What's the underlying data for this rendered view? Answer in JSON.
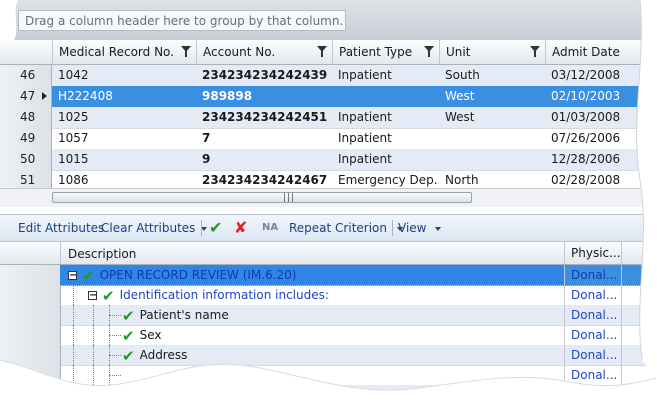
{
  "group_hint": "Drag a column header here to group by that column.",
  "columns": [
    "Medical Record No.",
    "Account No.",
    "Patient Type",
    "Unit",
    "Admit Date"
  ],
  "rows": [
    {
      "rownum": "46",
      "mrn": "1042",
      "account": "234234234242439",
      "type": "Inpatient",
      "unit": "South",
      "admit": "03/12/2008",
      "state": "alt"
    },
    {
      "rownum": "47",
      "mrn": "H222408",
      "account": "989898",
      "type": "",
      "unit": "West",
      "admit": "02/10/2003",
      "state": "sel"
    },
    {
      "rownum": "48",
      "mrn": "1025",
      "account": "234234234242451",
      "type": "Inpatient",
      "unit": "West",
      "admit": "01/03/2008",
      "state": "alt"
    },
    {
      "rownum": "49",
      "mrn": "1057",
      "account": "7",
      "type": "Inpatient",
      "unit": "",
      "admit": "07/26/2006",
      "state": ""
    },
    {
      "rownum": "50",
      "mrn": "1015",
      "account": "9",
      "type": "Inpatient",
      "unit": "",
      "admit": "12/28/2006",
      "state": "alt"
    },
    {
      "rownum": "51",
      "mrn": "1086",
      "account": "234234234242467",
      "type": "Emergency  Dep...",
      "unit": "North",
      "admit": "02/28/2008",
      "state": ""
    }
  ],
  "toolbar": {
    "edit": "Edit Attributes",
    "clear": "Clear Attributes",
    "na": "NA",
    "repeat": "Repeat Criterion",
    "view": "View"
  },
  "tree_columns": {
    "description": "Description",
    "phys": "Physic..."
  },
  "tree_rows": [
    {
      "level": 0,
      "text": "OPEN RECORD REVIEW (IM.6.20)",
      "phys": "Donal...",
      "expander": "⊟",
      "blue": true,
      "state": "sel"
    },
    {
      "level": 1,
      "text": "Identification information includes:",
      "phys": "Donal...",
      "expander": "⊟",
      "blue": true,
      "state": ""
    },
    {
      "level": 2,
      "text": "Patient's name",
      "phys": "Donal...",
      "expander": "",
      "blue": false,
      "state": "alt"
    },
    {
      "level": 2,
      "text": "Sex",
      "phys": "Donal...",
      "expander": "",
      "blue": false,
      "state": ""
    },
    {
      "level": 2,
      "text": "Address",
      "phys": "Donal...",
      "expander": "",
      "blue": false,
      "state": "alt"
    },
    {
      "level": 2,
      "text": "",
      "phys": "Donal...",
      "expander": "",
      "blue": false,
      "state": ""
    },
    {
      "level": 2,
      "text": "",
      "phys": "Donal...",
      "expander": "",
      "blue": false,
      "state": "alt"
    }
  ],
  "colors": {
    "selected": "#3b8fe0",
    "check": "#1e9a2a",
    "x": "#e0232d",
    "link": "#1e3f80"
  }
}
